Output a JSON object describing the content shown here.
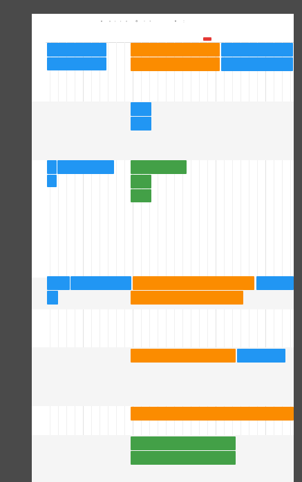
{
  "toolbar": {
    "field1_caption": "",
    "field1_value": "",
    "field2_caption": "",
    "field2_value": "",
    "field3_value": "",
    "field4_value": ""
  },
  "datebar": {
    "label": "",
    "date_left": "",
    "date_right": ""
  },
  "lanes": [
    {
      "label": ""
    },
    {
      "label": ""
    },
    {
      "label": ""
    },
    {
      "label": ""
    },
    {
      "label": ""
    },
    {
      "label": ""
    },
    {
      "label": ""
    },
    {
      "label": ""
    },
    {
      "label": ""
    }
  ],
  "colors": {
    "blue": "#2196f3",
    "orange": "#fb8c00",
    "green": "#43a047",
    "now_marker": "#e53935"
  },
  "events": [
    {
      "color": "blue"
    },
    {
      "color": "blue"
    },
    {
      "color": "orange"
    },
    {
      "color": "orange"
    },
    {
      "color": "blue"
    },
    {
      "color": "blue"
    },
    {
      "color": "blue"
    },
    {
      "color": "blue"
    },
    {
      "color": "blue"
    },
    {
      "color": "blue"
    },
    {
      "color": "blue"
    },
    {
      "color": "green"
    },
    {
      "color": "green"
    },
    {
      "color": "green"
    },
    {
      "color": "blue"
    },
    {
      "color": "blue"
    },
    {
      "color": "blue"
    },
    {
      "color": "orange"
    },
    {
      "color": "blue"
    },
    {
      "color": "orange"
    },
    {
      "color": "orange"
    },
    {
      "color": "blue"
    },
    {
      "color": "orange"
    },
    {
      "color": "green"
    },
    {
      "color": "green"
    }
  ]
}
